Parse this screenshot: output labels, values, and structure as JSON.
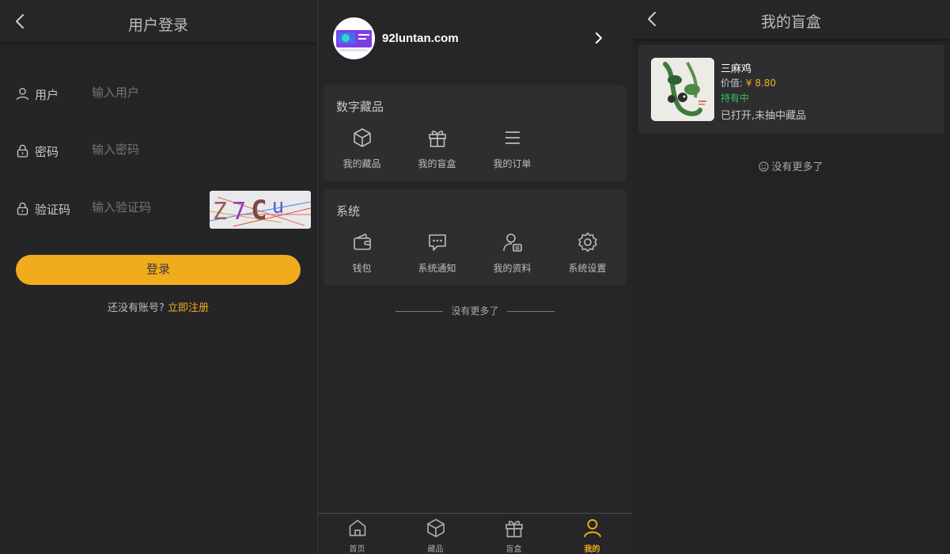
{
  "login": {
    "title": "用户登录",
    "fields": [
      {
        "label": "用户",
        "placeholder": "输入用户",
        "icon": "user-icon"
      },
      {
        "label": "密码",
        "placeholder": "输入密码",
        "icon": "lock-icon"
      },
      {
        "label": "验证码",
        "placeholder": "输入验证码",
        "icon": "lock-icon"
      }
    ],
    "captcha_text": "Z7Cu",
    "submit_label": "登录",
    "register_prompt": "还没有账号?",
    "register_link": "立即注册"
  },
  "mine": {
    "site_name": "92luntan.com",
    "collections": {
      "title": "数字藏品",
      "items": [
        {
          "label": "我的藏品",
          "icon": "cube-icon"
        },
        {
          "label": "我的盲盒",
          "icon": "gift-icon"
        },
        {
          "label": "我的订单",
          "icon": "list-icon"
        }
      ]
    },
    "system": {
      "title": "系统",
      "items": [
        {
          "label": "钱包",
          "icon": "wallet-icon"
        },
        {
          "label": "系统通知",
          "icon": "message-icon"
        },
        {
          "label": "我的资料",
          "icon": "profile-icon"
        },
        {
          "label": "系统设置",
          "icon": "gear-icon"
        }
      ]
    },
    "no_more": "没有更多了",
    "tabs": [
      {
        "label": "首页",
        "icon": "home-icon",
        "active": false
      },
      {
        "label": "藏品",
        "icon": "cube-icon",
        "active": false
      },
      {
        "label": "盲盒",
        "icon": "gift-icon",
        "active": false
      },
      {
        "label": "我的",
        "icon": "user-icon",
        "active": true
      }
    ]
  },
  "blindbox": {
    "title": "我的盲盒",
    "item": {
      "name": "三麻鸡",
      "value_label": "价值:",
      "value": "¥ 8.80",
      "status": "持有中",
      "note": "已打开,未抽中藏品"
    },
    "no_more": "没有更多了"
  },
  "colors": {
    "accent": "#f0ac1c",
    "status_green": "#2fc25b",
    "background": "#252527",
    "card": "#2e2e30"
  }
}
